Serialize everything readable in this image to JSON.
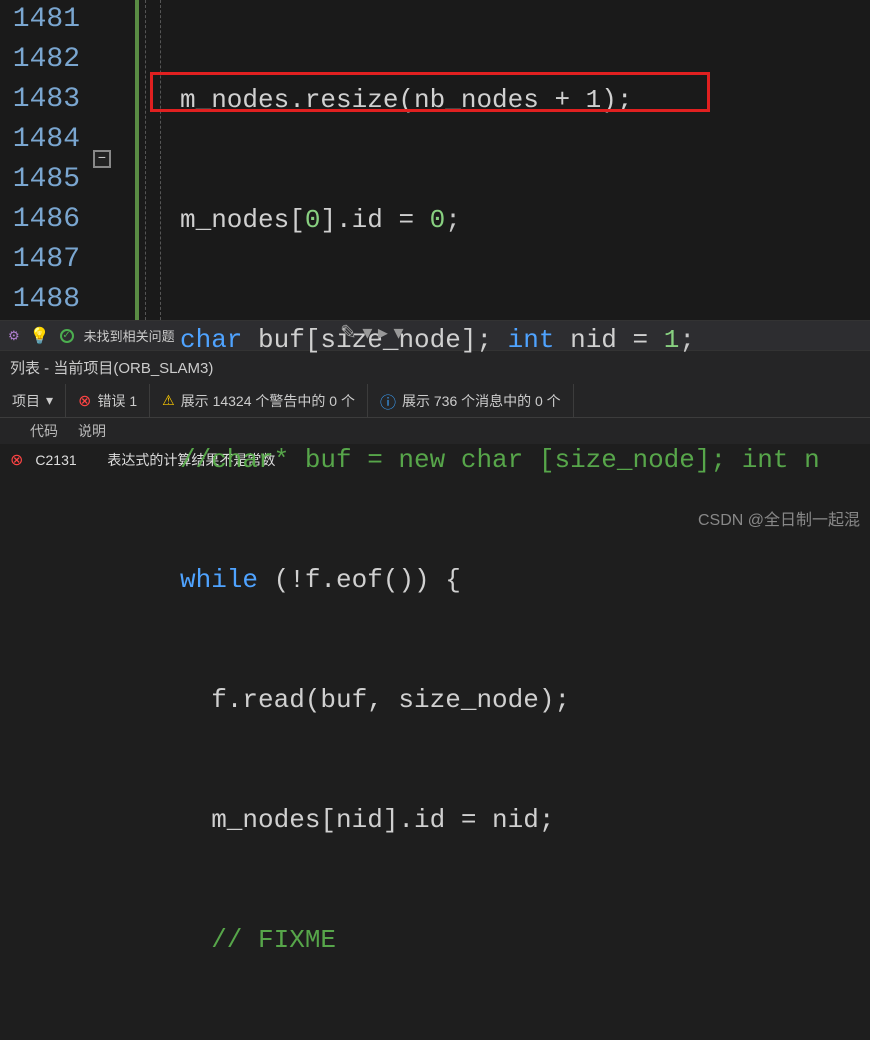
{
  "line_numbers": [
    "1481",
    "1482",
    "1483",
    "1484",
    "1485",
    "1486",
    "1487",
    "1488"
  ],
  "code": {
    "l1": {
      "text": "m_nodes.resize(nb_nodes + 1);"
    },
    "l2": {
      "prefix": "m_nodes[",
      "idx": "0",
      "mid": "].id = ",
      "val": "0",
      "end": ";"
    },
    "l3": {
      "kw1": "char",
      "id1": " buf[size_node]; ",
      "kw2": "int",
      "id2": " nid = ",
      "val": "1",
      "end": ";"
    },
    "l4": {
      "cmt": "//char* buf = new char [size_node]; int n"
    },
    "l5": {
      "kw": "while",
      "body": " (!f.eof()) {"
    },
    "l6": {
      "text": "  f.read(buf, size_node);"
    },
    "l7": {
      "text": "  m_nodes[nid].id = nid;"
    },
    "l8": {
      "cmt": "  // FIXME"
    }
  },
  "status": {
    "no_issues": "未找到相关问题"
  },
  "panel": {
    "title": "列表 - 当前项目(ORB_SLAM3)",
    "dropdown": "项目",
    "errors_label": "错误 1",
    "warnings_label": "展示 14324 个警告中的 0 个",
    "messages_label": "展示 736 个消息中的 0 个",
    "col_code": "代码",
    "col_desc": "说明"
  },
  "error": {
    "code": "C2131",
    "desc": "表达式的计算结果不是常数"
  },
  "watermark": "CSDN @全日制一起混"
}
